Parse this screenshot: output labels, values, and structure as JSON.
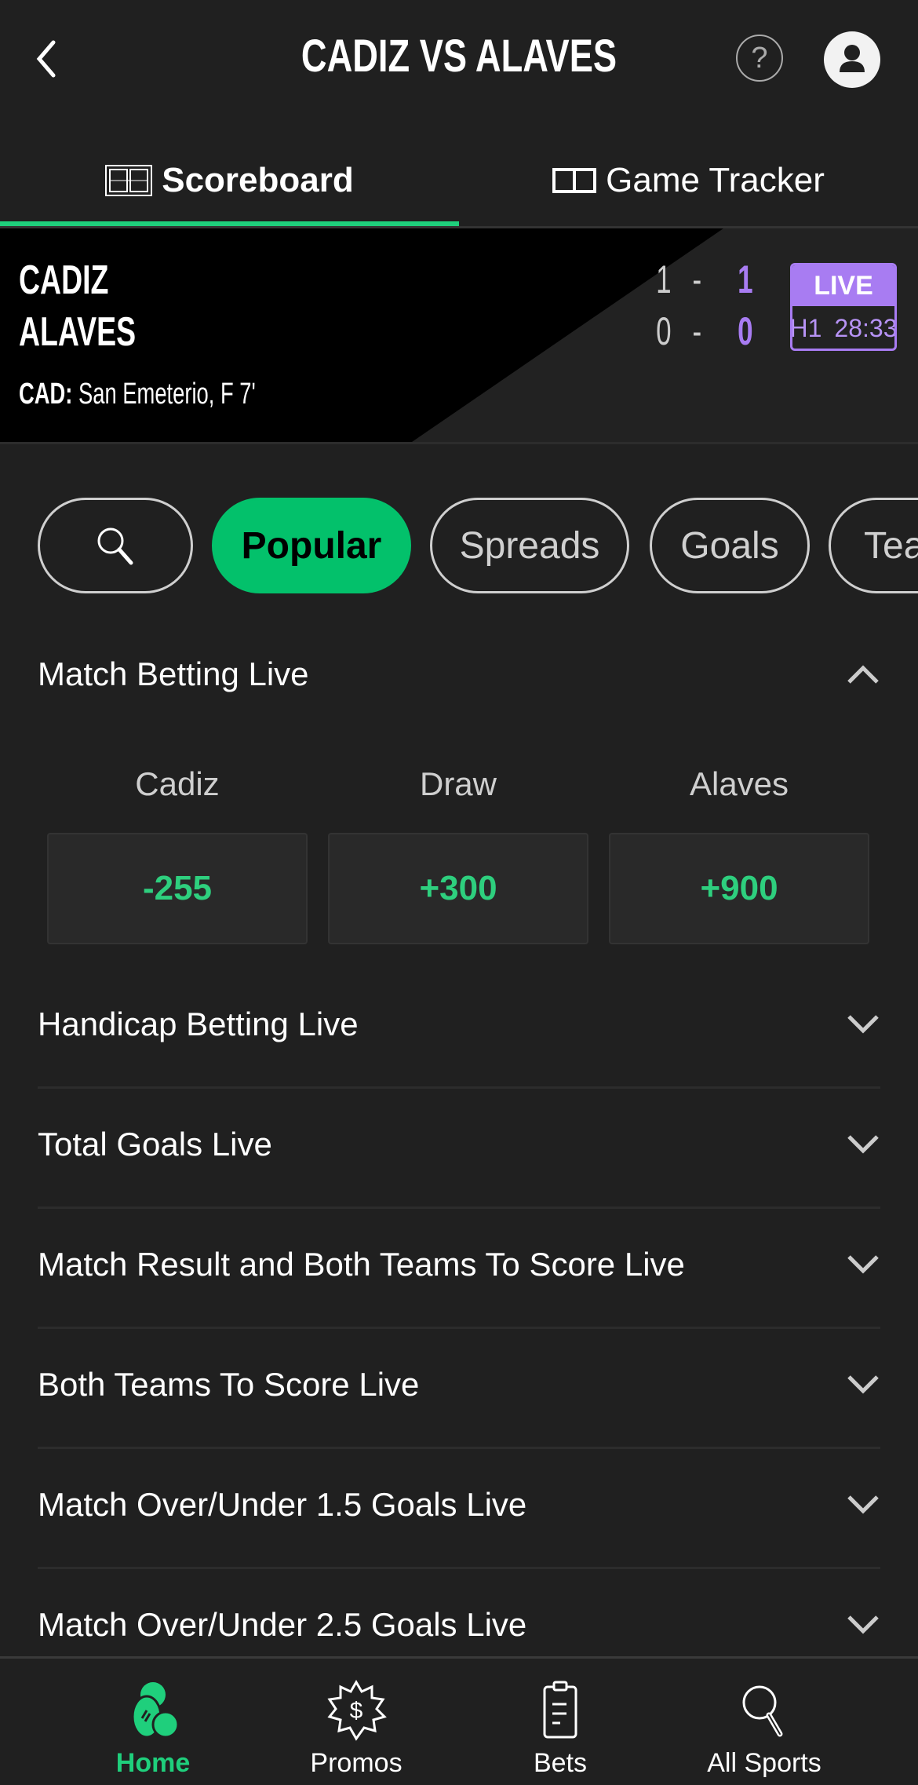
{
  "header": {
    "title": "CADIZ VS ALAVES",
    "back_icon": "chevron-left-icon",
    "help_icon": "question-mark-icon",
    "help_glyph": "?",
    "account_icon": "user-account-icon"
  },
  "tabs": [
    {
      "label": "Scoreboard",
      "icon": "scoreboard-icon",
      "active": true
    },
    {
      "label": "Game Tracker",
      "icon": "game-tracker-icon",
      "active": false
    }
  ],
  "scoreboard": {
    "home_team": "CADIZ",
    "away_team": "ALAVES",
    "home_first": "1",
    "home_total": "1",
    "away_first": "0",
    "away_total": "0",
    "dash": "-",
    "scorer_prefix": "CAD:",
    "scorer_text": "San Emeterio, F 7'",
    "status_badge": "LIVE",
    "period": "H1",
    "clock": "28:33",
    "colors": {
      "accent": "#a87cf2",
      "home_bg": "#000000"
    }
  },
  "filters": [
    {
      "label": "",
      "icon": "search-icon",
      "active": false
    },
    {
      "label": "Popular",
      "active": true
    },
    {
      "label": "Spreads",
      "active": false
    },
    {
      "label": "Goals",
      "active": false
    },
    {
      "label": "Team",
      "active": false
    }
  ],
  "markets": {
    "expanded": {
      "title": "Match Betting Live",
      "columns": [
        "Cadiz",
        "Draw",
        "Alaves"
      ],
      "odds": [
        "-255",
        "+300",
        "+900"
      ]
    },
    "collapsed": [
      "Handicap Betting Live",
      "Total Goals Live",
      "Match Result and Both Teams To Score Live",
      "Both Teams To Score Live",
      "Match Over/Under 1.5 Goals Live",
      "Match Over/Under 2.5 Goals Live"
    ]
  },
  "bottom_nav": [
    {
      "label": "Home",
      "icon": "home-sports-icon",
      "active": true
    },
    {
      "label": "Promos",
      "icon": "promos-dollar-badge-icon",
      "active": false
    },
    {
      "label": "Bets",
      "icon": "bets-clipboard-icon",
      "active": false
    },
    {
      "label": "All Sports",
      "icon": "search-icon",
      "active": false
    }
  ],
  "colors": {
    "brand_green": "#03c16b",
    "odds_green": "#2ecf7e",
    "live_purple": "#a87cf2",
    "background": "#202020"
  }
}
